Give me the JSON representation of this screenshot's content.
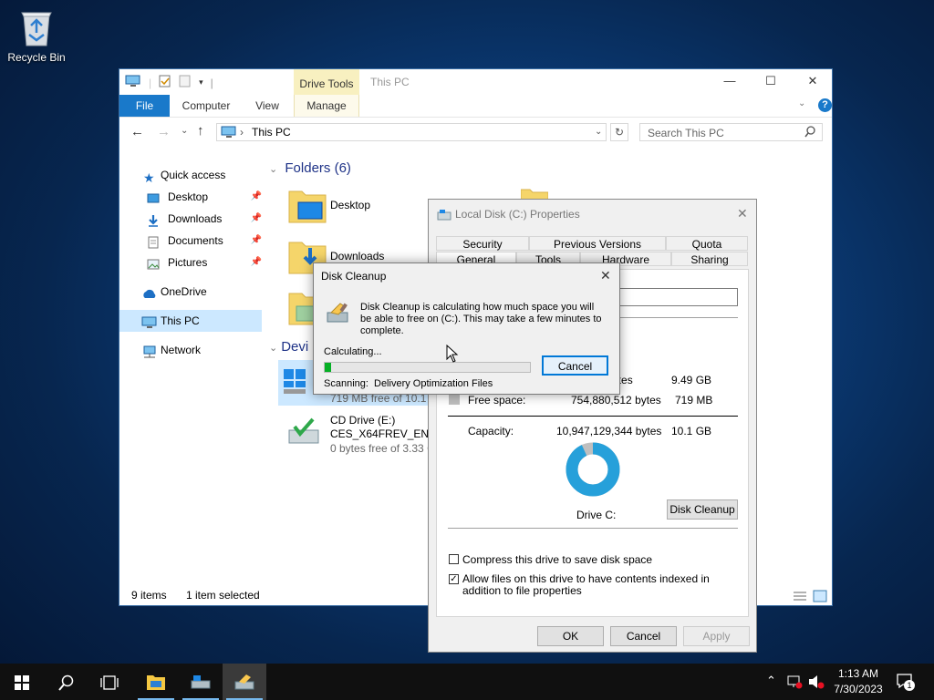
{
  "desktop": {
    "recycle_bin_label": "Recycle Bin"
  },
  "explorer": {
    "contextual_tab": "Drive Tools",
    "title": "This PC",
    "ribbon_tabs": [
      "File",
      "Computer",
      "View",
      "Manage"
    ],
    "address": "This PC",
    "search_placeholder": "Search This PC",
    "sidebar": [
      {
        "label": "Quick access",
        "icon": "star-icon"
      },
      {
        "label": "Desktop",
        "icon": "desktop-icon",
        "pinned": true
      },
      {
        "label": "Downloads",
        "icon": "download-arrow-icon",
        "pinned": true
      },
      {
        "label": "Documents",
        "icon": "document-icon",
        "pinned": true
      },
      {
        "label": "Pictures",
        "icon": "picture-icon",
        "pinned": true
      },
      {
        "label": "OneDrive",
        "icon": "cloud-icon"
      },
      {
        "label": "This PC",
        "icon": "computer-icon",
        "selected": true
      },
      {
        "label": "Network",
        "icon": "network-icon"
      }
    ],
    "folders_header": "Folders (6)",
    "folders": [
      "Desktop",
      "Downloads"
    ],
    "devices_header": "Devi",
    "drive_c_free": "719 MB free of 10.1 G",
    "cd_drive": {
      "name": "CD Drive (E:)",
      "label": "CES_X64FREV_EN-US",
      "free": "0 bytes free of 3.33 G"
    },
    "status": {
      "items": "9 items",
      "selected": "1 item selected"
    }
  },
  "properties": {
    "title": "Local Disk (C:) Properties",
    "tabs_row1": [
      "Security",
      "Previous Versions",
      "Quota"
    ],
    "tabs_row2": [
      "General",
      "Tools",
      "Hardware",
      "Sharing"
    ],
    "used_bytes_partial": "2 bytes",
    "used_size": "9.49 GB",
    "free_label": "Free space:",
    "free_bytes": "754,880,512 bytes",
    "free_size": "719 MB",
    "capacity_label": "Capacity:",
    "capacity_bytes": "10,947,129,344 bytes",
    "capacity_size": "10.1 GB",
    "drive_label": "Drive C:",
    "disk_cleanup_button": "Disk Cleanup",
    "compress_label": "Compress this drive to save disk space",
    "index_label": "Allow files on this drive to have contents indexed in addition to file properties",
    "compress_checked": false,
    "index_checked": true,
    "used_fraction": 0.931,
    "ok": "OK",
    "cancel": "Cancel",
    "apply": "Apply",
    "colors": {
      "used": "#26a0da",
      "free": "#bfbfbf"
    }
  },
  "cleanup": {
    "title": "Disk Cleanup",
    "message": "Disk Cleanup is calculating how much space you will be able to free on  (C:). This may take a few minutes to complete.",
    "calculating": "Calculating...",
    "cancel": "Cancel",
    "scanning_label": "Scanning:",
    "scanning_item": "Delivery Optimization Files",
    "progress": 0.03,
    "progress_color": "#06b025"
  },
  "taskbar": {
    "time": "1:13 AM",
    "date": "7/30/2023",
    "notification_count": "1"
  }
}
